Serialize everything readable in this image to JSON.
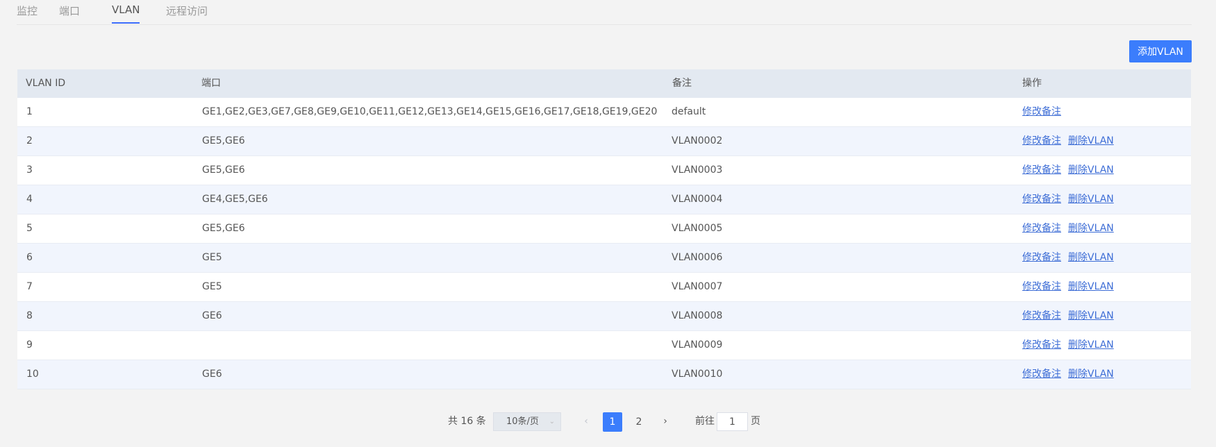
{
  "tabs": [
    {
      "label": "监控",
      "active": false
    },
    {
      "label": "端口",
      "active": false
    },
    {
      "label": "VLAN",
      "active": true
    },
    {
      "label": "远程访问",
      "active": false
    }
  ],
  "toolbar": {
    "add_label": "添加VLAN"
  },
  "table": {
    "headers": [
      "VLAN ID",
      "端口",
      "备注",
      "操作"
    ],
    "rows": [
      {
        "id": "1",
        "ports": "GE1,GE2,GE3,GE7,GE8,GE9,GE10,GE11,GE12,GE13,GE14,GE15,GE16,GE17,GE18,GE19,GE20",
        "note": "default",
        "edit": "修改备注",
        "delete": ""
      },
      {
        "id": "2",
        "ports": "GE5,GE6",
        "note": "VLAN0002",
        "edit": "修改备注",
        "delete": "删除VLAN"
      },
      {
        "id": "3",
        "ports": "GE5,GE6",
        "note": "VLAN0003",
        "edit": "修改备注",
        "delete": "删除VLAN"
      },
      {
        "id": "4",
        "ports": "GE4,GE5,GE6",
        "note": "VLAN0004",
        "edit": "修改备注",
        "delete": "删除VLAN"
      },
      {
        "id": "5",
        "ports": "GE5,GE6",
        "note": "VLAN0005",
        "edit": "修改备注",
        "delete": "删除VLAN"
      },
      {
        "id": "6",
        "ports": "GE5",
        "note": "VLAN0006",
        "edit": "修改备注",
        "delete": "删除VLAN"
      },
      {
        "id": "7",
        "ports": "GE5",
        "note": "VLAN0007",
        "edit": "修改备注",
        "delete": "删除VLAN"
      },
      {
        "id": "8",
        "ports": "GE6",
        "note": "VLAN0008",
        "edit": "修改备注",
        "delete": "删除VLAN"
      },
      {
        "id": "9",
        "ports": "",
        "note": "VLAN0009",
        "edit": "修改备注",
        "delete": "删除VLAN"
      },
      {
        "id": "10",
        "ports": "GE6",
        "note": "VLAN0010",
        "edit": "修改备注",
        "delete": "删除VLAN"
      }
    ]
  },
  "pagination": {
    "total_label": "共 16 条",
    "page_size_label": "10条/页",
    "pages": [
      "1",
      "2"
    ],
    "current_page": "1",
    "goto_label": "前往",
    "goto_value": "1",
    "goto_suffix": "页",
    "prev_icon": "chevron-left-icon",
    "next_icon": "chevron-right-icon"
  },
  "colors": {
    "accent": "#3b7dfc",
    "link": "#3d6dd6",
    "header_bg": "#e3e9f1",
    "row_alt_bg": "#f1f5fd"
  }
}
